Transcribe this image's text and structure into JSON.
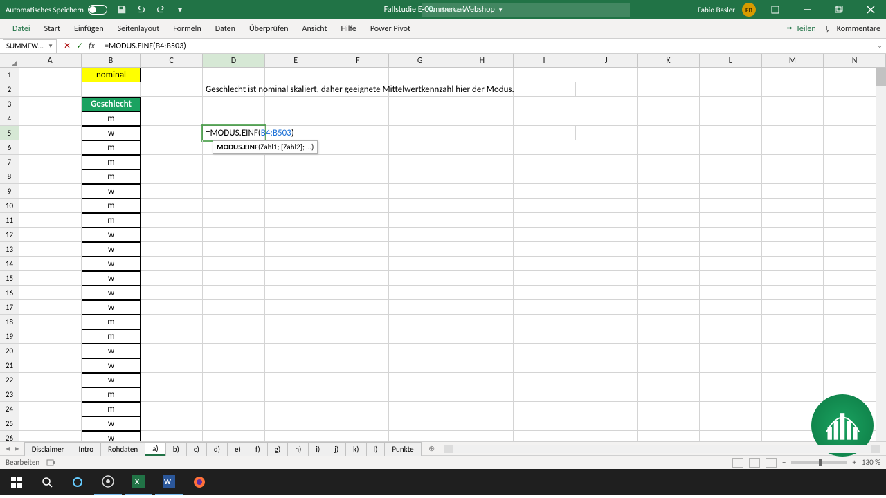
{
  "title_bar": {
    "autosave_label": "Automatisches Speichern",
    "doc_title": "Fallstudie E-Commerce Webshop",
    "search_placeholder": "Suchen",
    "user_name": "Fabio Basler",
    "user_initials": "FB"
  },
  "ribbon": {
    "tabs": [
      "Datei",
      "Start",
      "Einfügen",
      "Seitenlayout",
      "Formeln",
      "Daten",
      "Überprüfen",
      "Ansicht",
      "Hilfe",
      "Power Pivot"
    ],
    "share": "Teilen",
    "comments": "Kommentare"
  },
  "formula_bar": {
    "name_box": "SUMMEW…",
    "formula": "=MODUS.EINF(B4:B503)"
  },
  "columns": [
    "A",
    "B",
    "C",
    "D",
    "E",
    "F",
    "G",
    "H",
    "I",
    "J",
    "K",
    "L",
    "M",
    "N"
  ],
  "rows": [
    1,
    2,
    3,
    4,
    5,
    6,
    7,
    8,
    9,
    10,
    11,
    12,
    13,
    14,
    15,
    16,
    17,
    18,
    19,
    20,
    21,
    22,
    23,
    24,
    25,
    26
  ],
  "cells": {
    "B1": "nominal",
    "D2": "Geschlecht ist nominal skaliert, daher geeignete Mittelwertkennzahl hier der Modus.",
    "B3": "Geschlecht",
    "B_data": [
      "m",
      "w",
      "m",
      "m",
      "m",
      "w",
      "m",
      "m",
      "w",
      "w",
      "w",
      "w",
      "w",
      "w",
      "m",
      "m",
      "w",
      "w",
      "w",
      "m",
      "m",
      "w",
      "w"
    ]
  },
  "editing": {
    "prefix": "=MODUS.EINF(",
    "ref": "B4:B503",
    "suffix": ")",
    "tooltip_fn": "MODUS.EINF",
    "tooltip_args": "(Zahl1; [Zahl2]; …)"
  },
  "sheet_tabs": [
    "Disclaimer",
    "Intro",
    "Rohdaten",
    "a)",
    "b)",
    "c)",
    "d)",
    "e)",
    "f)",
    "g)",
    "h)",
    "i)",
    "j)",
    "k)",
    "l)",
    "Punkte"
  ],
  "active_sheet": "a)",
  "status": {
    "mode": "Bearbeiten",
    "zoom": "130 %"
  }
}
